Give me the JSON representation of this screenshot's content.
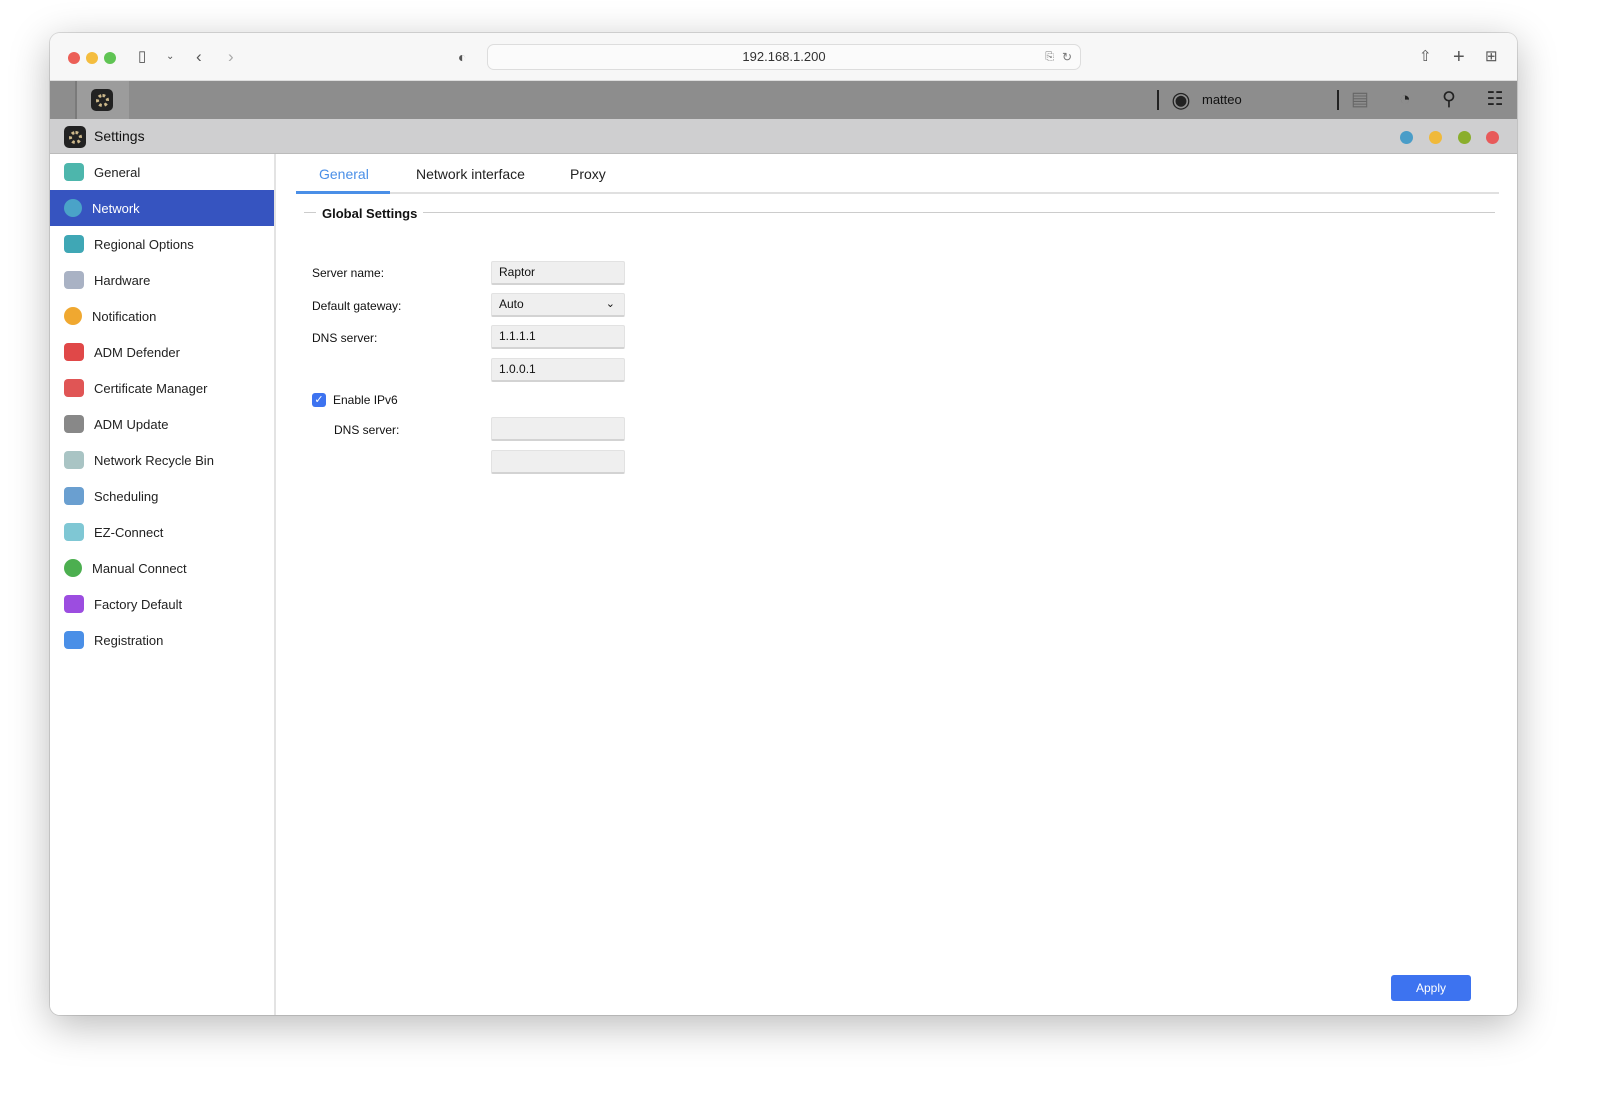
{
  "browser": {
    "url": "192.168.1.200"
  },
  "topbar": {
    "username": "matteo"
  },
  "window": {
    "title": "Settings"
  },
  "sidebar": {
    "items": [
      {
        "label": "General",
        "color": "#4db6ac"
      },
      {
        "label": "Network",
        "color": "#4aa3c8"
      },
      {
        "label": "Regional Options",
        "color": "#3fa7b5"
      },
      {
        "label": "Hardware",
        "color": "#a9b2c4"
      },
      {
        "label": "Notification",
        "color": "#f0a830"
      },
      {
        "label": "ADM Defender",
        "color": "#e04848"
      },
      {
        "label": "Certificate Manager",
        "color": "#e05555"
      },
      {
        "label": "ADM Update",
        "color": "#888888"
      },
      {
        "label": "Network Recycle Bin",
        "color": "#a9c4c4"
      },
      {
        "label": "Scheduling",
        "color": "#6a9fd0"
      },
      {
        "label": "EZ-Connect",
        "color": "#7fc7d4"
      },
      {
        "label": "Manual Connect",
        "color": "#4caf50"
      },
      {
        "label": "Factory Default",
        "color": "#9c4de0"
      },
      {
        "label": "Registration",
        "color": "#4a8fe7"
      }
    ]
  },
  "tabs": [
    "General",
    "Network interface",
    "Proxy"
  ],
  "form": {
    "section_title": "Global Settings",
    "server_name_label": "Server name:",
    "server_name": "Raptor",
    "gateway_label": "Default gateway:",
    "gateway": "Auto",
    "dns_label": "DNS server:",
    "dns1": "1.1.1.1",
    "dns2": "1.0.0.1",
    "ipv6_label": "Enable IPv6",
    "ipv6_checked": true,
    "ipv6_dns_label": "DNS server:",
    "ipv6_dns1": "",
    "ipv6_dns2": ""
  },
  "apply_label": "Apply"
}
